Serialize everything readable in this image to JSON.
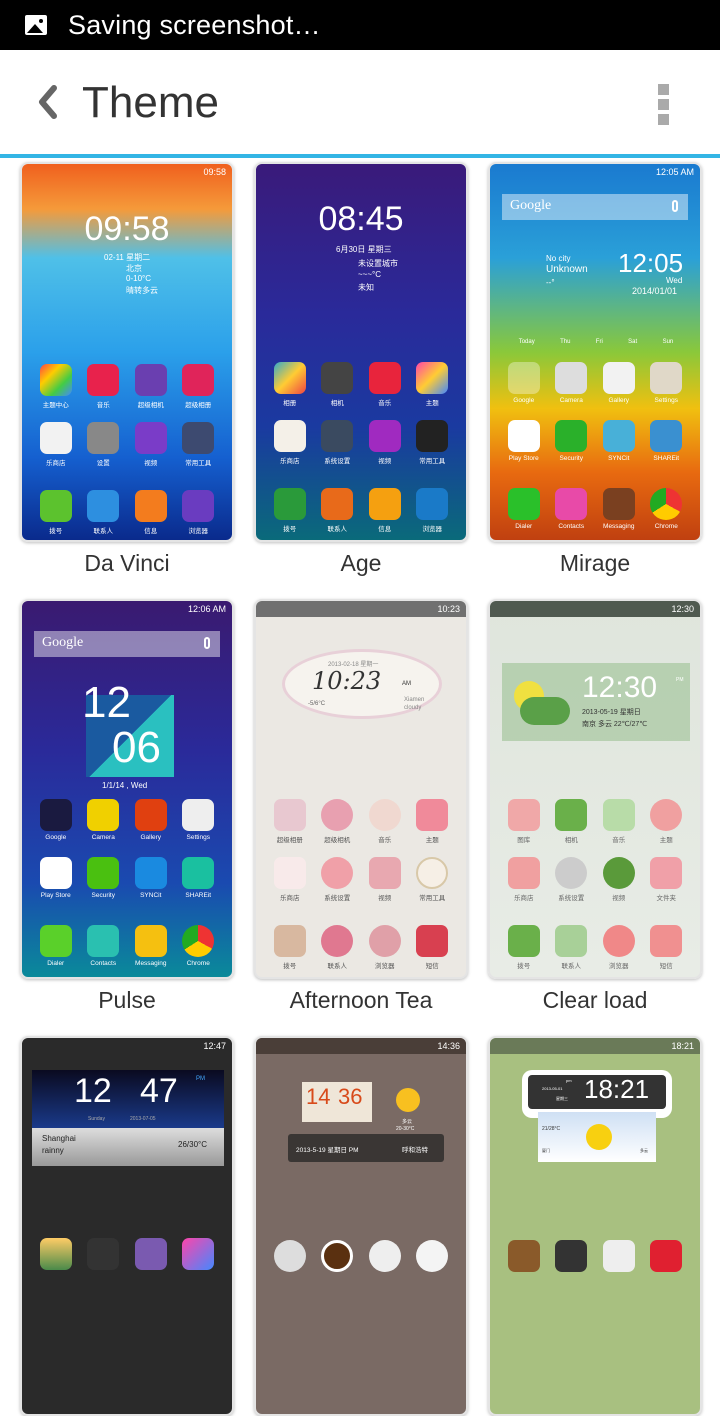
{
  "status_bar": {
    "icon": "image-icon",
    "text": "Saving screenshot…"
  },
  "app_bar": {
    "back_icon": "chevron-left-icon",
    "title": "Theme",
    "menu_icon": "overflow-menu-icon"
  },
  "colors": {
    "accent": "#33b5e5",
    "title_text": "#333333",
    "status_bar_bg": "#000000"
  },
  "themes": [
    {
      "name": "Da Vinci",
      "preview": {
        "status_time": "09:58",
        "clock": "09:58",
        "date": "02-11 星期二",
        "city": "北京",
        "temp": "0-10°C",
        "weather": "晴转多云",
        "rows": [
          [
            "主题中心",
            "音乐",
            "超级相机",
            "超级相册"
          ],
          [
            "乐商店",
            "设置",
            "视频",
            "常用工具"
          ],
          [
            "拨号",
            "联系人",
            "信息",
            "浏览器"
          ]
        ]
      }
    },
    {
      "name": "Age",
      "preview": {
        "clock": "08:45",
        "date": "6月30日 星期三",
        "city": "未设置城市",
        "temp": "~~~°C",
        "weather": "未知",
        "rows": [
          [
            "相册",
            "相机",
            "音乐",
            "主题"
          ],
          [
            "乐商店",
            "系统设置",
            "视频",
            "常用工具"
          ],
          [
            "拨号",
            "联系人",
            "信息",
            "浏览器"
          ]
        ]
      }
    },
    {
      "name": "Mirage",
      "preview": {
        "status_time": "12:05 AM",
        "search": "Google",
        "clock": "12:05",
        "day": "Wed",
        "date": "2014/01/01",
        "city": "No city",
        "weather": "Unknown",
        "temp": "--°",
        "forecast": [
          "Today",
          "Thu",
          "Fri",
          "Sat",
          "Sun"
        ],
        "rows": [
          [
            "Google",
            "Camera",
            "Gallery",
            "Settings"
          ],
          [
            "Play Store",
            "Security",
            "SYNCit",
            "SHAREit"
          ],
          [
            "Dialer",
            "Contacts",
            "Messaging",
            "Chrome"
          ]
        ]
      }
    },
    {
      "name": "Pulse",
      "preview": {
        "status_time": "12:06 AM",
        "search": "Google",
        "clock_hour": "12",
        "clock_min": "06",
        "date": "1/1/14 , Wed",
        "rows": [
          [
            "Google",
            "Camera",
            "Gallery",
            "Settings"
          ],
          [
            "Play Store",
            "Security",
            "SYNCit",
            "SHAREit"
          ],
          [
            "Dialer",
            "Contacts",
            "Messaging",
            "Chrome"
          ]
        ]
      }
    },
    {
      "name": "Afternoon Tea",
      "preview": {
        "status_time": "10:23",
        "clock": "10:23",
        "ampm": "AM",
        "date": "2013-02-18 星期一",
        "temp": "-5/6°C",
        "city": "Xiamen",
        "weather": "cloudy",
        "rows": [
          [
            "超级相册",
            "超级相机",
            "音乐",
            "主题"
          ],
          [
            "乐商店",
            "系统设置",
            "视频",
            "常用工具"
          ],
          [
            "拨号",
            "联系人",
            "浏览器",
            "短信"
          ]
        ]
      }
    },
    {
      "name": "Clear load",
      "preview": {
        "status_time": "12:30",
        "clock": "12:30",
        "ampm": "PM",
        "date": "2013-05-19 星期日",
        "weather": "南京 多云 22℃/27℃",
        "rows": [
          [
            "图库",
            "相机",
            "音乐",
            "主题"
          ],
          [
            "乐商店",
            "系统设置",
            "视频",
            "文件夹"
          ],
          [
            "拨号",
            "联系人",
            "浏览器",
            "短信"
          ]
        ]
      }
    },
    {
      "name": "",
      "preview": {
        "status_time": "12:47",
        "clock_hour": "12",
        "clock_min": "47",
        "ampm": "PM",
        "day": "Sunday",
        "date": "2013-07-05",
        "city": "Shanghai",
        "weather": "rainny",
        "temp": "26/30°C"
      }
    },
    {
      "name": "",
      "preview": {
        "status_time": "14:36",
        "clock_hour": "14",
        "clock_min": "36",
        "weather": "多云",
        "temp": "20-30°C",
        "date": "2013-5-19  星期日  PM",
        "city": "呼和浩特"
      }
    },
    {
      "name": "",
      "preview": {
        "status_time": "18:21",
        "clock": "18:21",
        "ampm": "pm",
        "date": "2013-05-01",
        "day": "星期三",
        "temp": "21/28°C",
        "city": "厦门",
        "weather": "多云"
      }
    }
  ]
}
